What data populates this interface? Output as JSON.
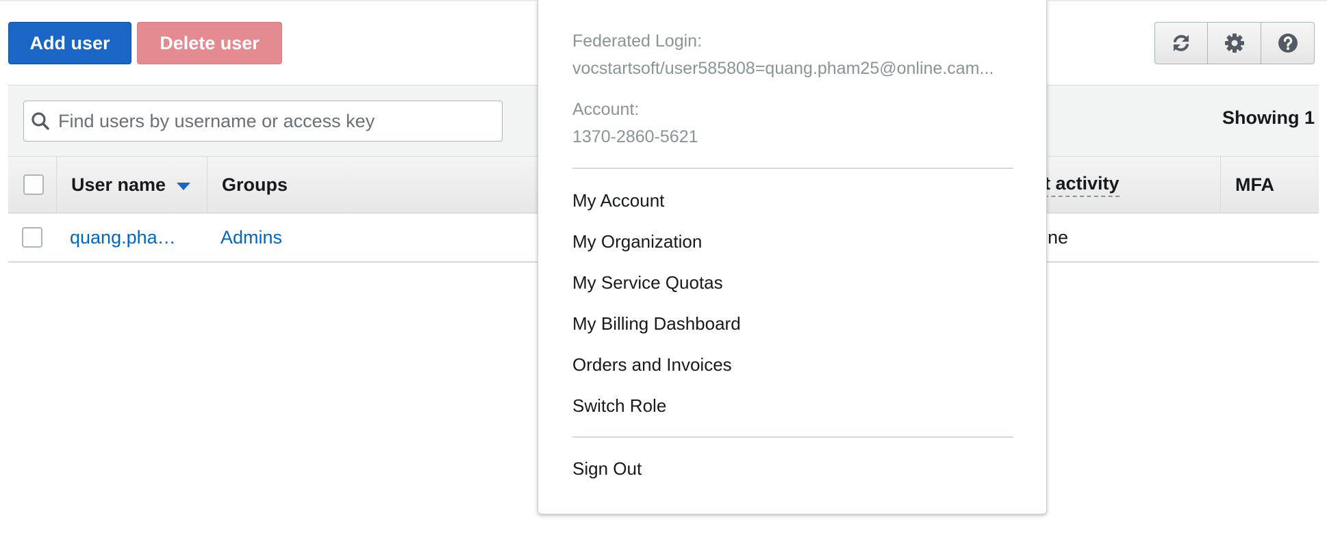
{
  "toolbar": {
    "add_user_label": "Add user",
    "delete_user_label": "Delete user",
    "icons": [
      "refresh-icon",
      "gear-icon",
      "help-icon"
    ]
  },
  "filter": {
    "search_placeholder": "Find users by username or access key",
    "showing_text": "Showing 1"
  },
  "table": {
    "columns": [
      "User name",
      "Groups",
      "t activity",
      "MFA"
    ],
    "rows": [
      {
        "user_name": "quang.pha…",
        "groups": "Admins",
        "last_activity": "ne",
        "mfa": ""
      }
    ]
  },
  "account_menu": {
    "federated_login_label": "Federated Login:",
    "federated_login_value": "vocstartsoft/user585808=quang.pham25@online.cam...",
    "account_label": "Account:",
    "account_value": "1370-2860-5621",
    "items": [
      "My Account",
      "My Organization",
      "My Service Quotas",
      "My Billing Dashboard",
      "Orders and Invoices",
      "Switch Role"
    ],
    "sign_out_label": "Sign Out"
  },
  "colors": {
    "primary": "#1a66c5",
    "danger": "#e38b91",
    "link": "#0066c0",
    "muted_text": "#879596"
  }
}
